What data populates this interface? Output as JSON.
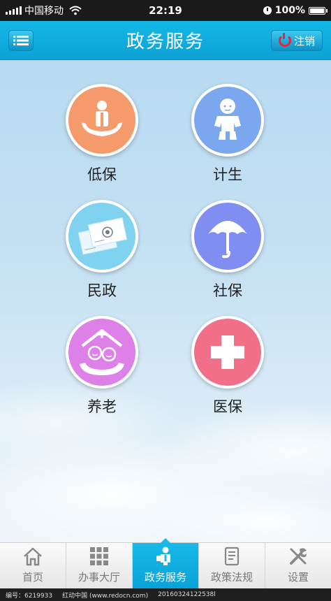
{
  "status_bar": {
    "carrier": "中国移动",
    "time": "22:19",
    "battery": "100%"
  },
  "nav": {
    "title": "政务服务",
    "logout_label": "注销"
  },
  "grid": [
    {
      "label": "低保",
      "icon": "person-hands-icon",
      "color": "#f59a6a"
    },
    {
      "label": "计生",
      "icon": "baby-icon",
      "color": "#7aa7ee"
    },
    {
      "label": "民政",
      "icon": "certificate-icon",
      "color": "#7fd3f0"
    },
    {
      "label": "社保",
      "icon": "umbrella-icon",
      "color": "#7f8ef0"
    },
    {
      "label": "养老",
      "icon": "elderly-care-icon",
      "color": "#dd80e8"
    },
    {
      "label": "医保",
      "icon": "medical-cross-icon",
      "color": "#f26f8a"
    }
  ],
  "tabs": [
    {
      "label": "首页",
      "icon": "home-icon"
    },
    {
      "label": "办事大厅",
      "icon": "grid-icon"
    },
    {
      "label": "政务服务",
      "icon": "service-person-icon",
      "active": true
    },
    {
      "label": "政策法规",
      "icon": "document-icon"
    },
    {
      "label": "设置",
      "icon": "tools-icon"
    }
  ],
  "footer": {
    "id_text": "编号：6219933",
    "site_text": "红动中国 (www.redocn.com)",
    "code_text": "20160324122538l"
  }
}
